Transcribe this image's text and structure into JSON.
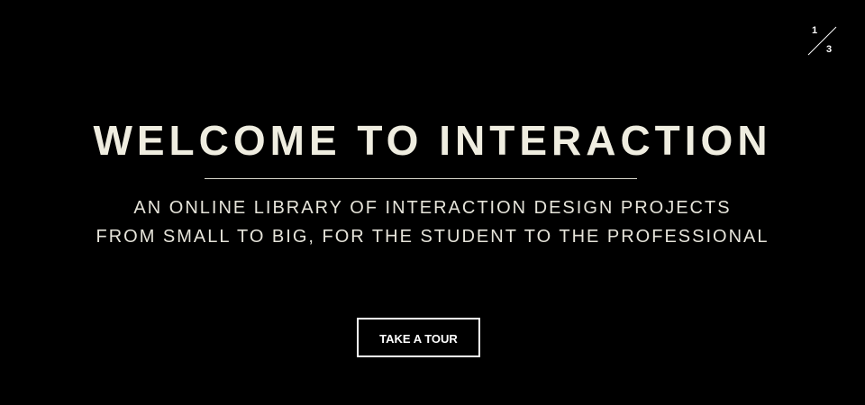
{
  "slide_counter": {
    "current": "1",
    "total": "3"
  },
  "hero": {
    "title": "WELCOME TO INTERACTION",
    "subtitle_line1": "AN ONLINE LIBRARY OF INTERACTION DESIGN PROJECTS",
    "subtitle_line2": "FROM SMALL TO BIG, FOR THE STUDENT TO THE PROFESSIONAL",
    "cta_label": "TAKE A TOUR"
  },
  "colors": {
    "background": "#000000",
    "text": "#efede0",
    "button_border": "#ffffff"
  }
}
